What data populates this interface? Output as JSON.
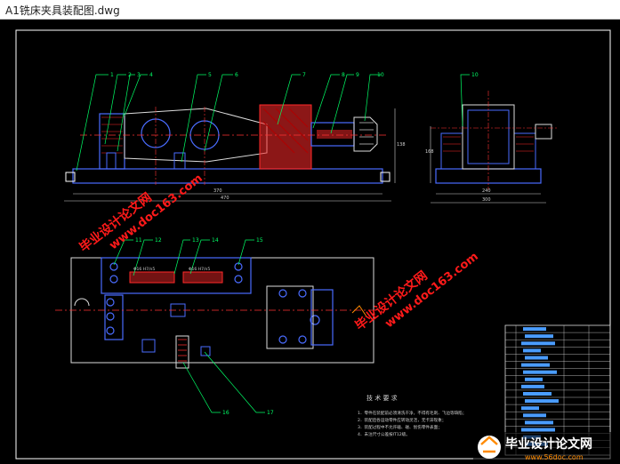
{
  "window": {
    "title": "A1铣床夹具装配图.dwg"
  },
  "colors": {
    "frame": "#ffffff",
    "part": "#4a6cff",
    "hatch": "#ff2a2a",
    "leader": "#00ff66",
    "center": "#ff3333",
    "dim": "#d0d0d0",
    "watermark": "#ff1a1a",
    "accent_orange": "#ff8a00"
  },
  "balloons": {
    "front": [
      "1",
      "2",
      "3",
      "4",
      "5",
      "6",
      "7",
      "8",
      "9",
      "10"
    ],
    "side": [
      "10"
    ],
    "plan": [
      "11",
      "12",
      "13",
      "14",
      "15",
      "16",
      "17"
    ]
  },
  "fits": {
    "left": "Φ16 H7/n5",
    "right": "Φ16 H7/n5"
  },
  "dims": {
    "front_len": "370",
    "front_total": "470",
    "side_w": "240",
    "side_total": "300",
    "side_h": "168",
    "front_h": "138"
  },
  "tech": {
    "title": "技 术 要 求",
    "lines": [
      "1．零件在装配前必须清洗干净，不得有毛刺、飞边等缺陷；",
      "2．装配后各运动零件应转动灵活，无卡滞现象；",
      "3．装配过程中不允许磕、碰、划伤零件表面；",
      "4．未注尺寸公差按IT12级。"
    ]
  },
  "watermarks": {
    "text_cn": "毕业设计论文网",
    "text_url": "www.doc163.com",
    "logo_cn": "毕业设计论文网",
    "logo_url": "www.56doc.com"
  }
}
